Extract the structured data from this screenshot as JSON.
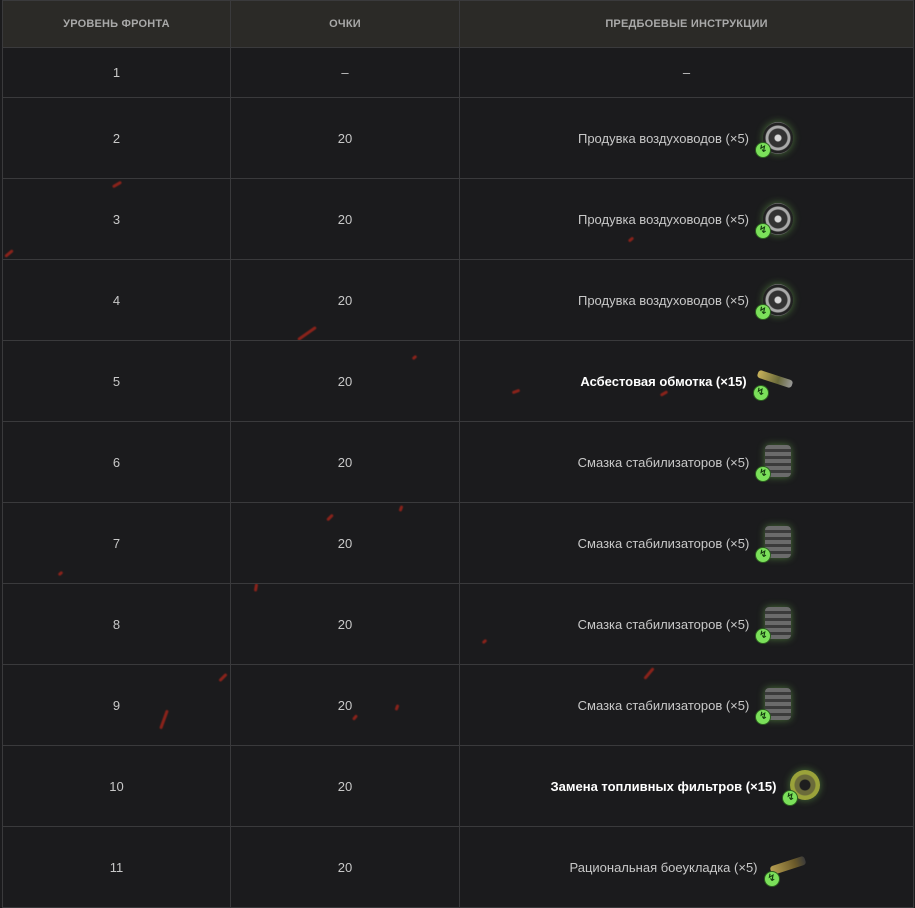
{
  "table": {
    "headers": [
      "УРОВЕНЬ ФРОНТА",
      "ОЧКИ",
      "ПРЕДБОЕВЫЕ ИНСТРУКЦИИ"
    ],
    "rows": [
      {
        "level": "1",
        "points": "–",
        "instruction": "–",
        "icon": "",
        "bold": false
      },
      {
        "level": "2",
        "points": "20",
        "instruction": "Продувка воздуховодов (×5)",
        "icon": "fan-icon",
        "bold": false
      },
      {
        "level": "3",
        "points": "20",
        "instruction": "Продувка воздуховодов (×5)",
        "icon": "fan-icon",
        "bold": false
      },
      {
        "level": "4",
        "points": "20",
        "instruction": "Продувка воздуховодов (×5)",
        "icon": "fan-icon",
        "bold": false
      },
      {
        "level": "5",
        "points": "20",
        "instruction": "Асбестовая обмотка (×15)",
        "icon": "asbestos-wrap-icon",
        "bold": true
      },
      {
        "level": "6",
        "points": "20",
        "instruction": "Смазка стабилизаторов (×5)",
        "icon": "stabilizer-lubricant-icon",
        "bold": false
      },
      {
        "level": "7",
        "points": "20",
        "instruction": "Смазка стабилизаторов (×5)",
        "icon": "stabilizer-lubricant-icon",
        "bold": false
      },
      {
        "level": "8",
        "points": "20",
        "instruction": "Смазка стабилизаторов (×5)",
        "icon": "stabilizer-lubricant-icon",
        "bold": false
      },
      {
        "level": "9",
        "points": "20",
        "instruction": "Смазка стабилизаторов (×5)",
        "icon": "stabilizer-lubricant-icon",
        "bold": false
      },
      {
        "level": "10",
        "points": "20",
        "instruction": "Замена топливных фильтров (×15)",
        "icon": "fuel-filter-icon",
        "bold": true
      },
      {
        "level": "11",
        "points": "20",
        "instruction": "Рациональная боеукладка (×5)",
        "icon": "ammo-rack-icon",
        "bold": false
      }
    ]
  },
  "colors": {
    "background": "#1b1b1d",
    "header_bg": "#2b2a27",
    "border": "#3a3a3c",
    "accent_green": "#7be05a",
    "spark_red": "#b8261a"
  }
}
